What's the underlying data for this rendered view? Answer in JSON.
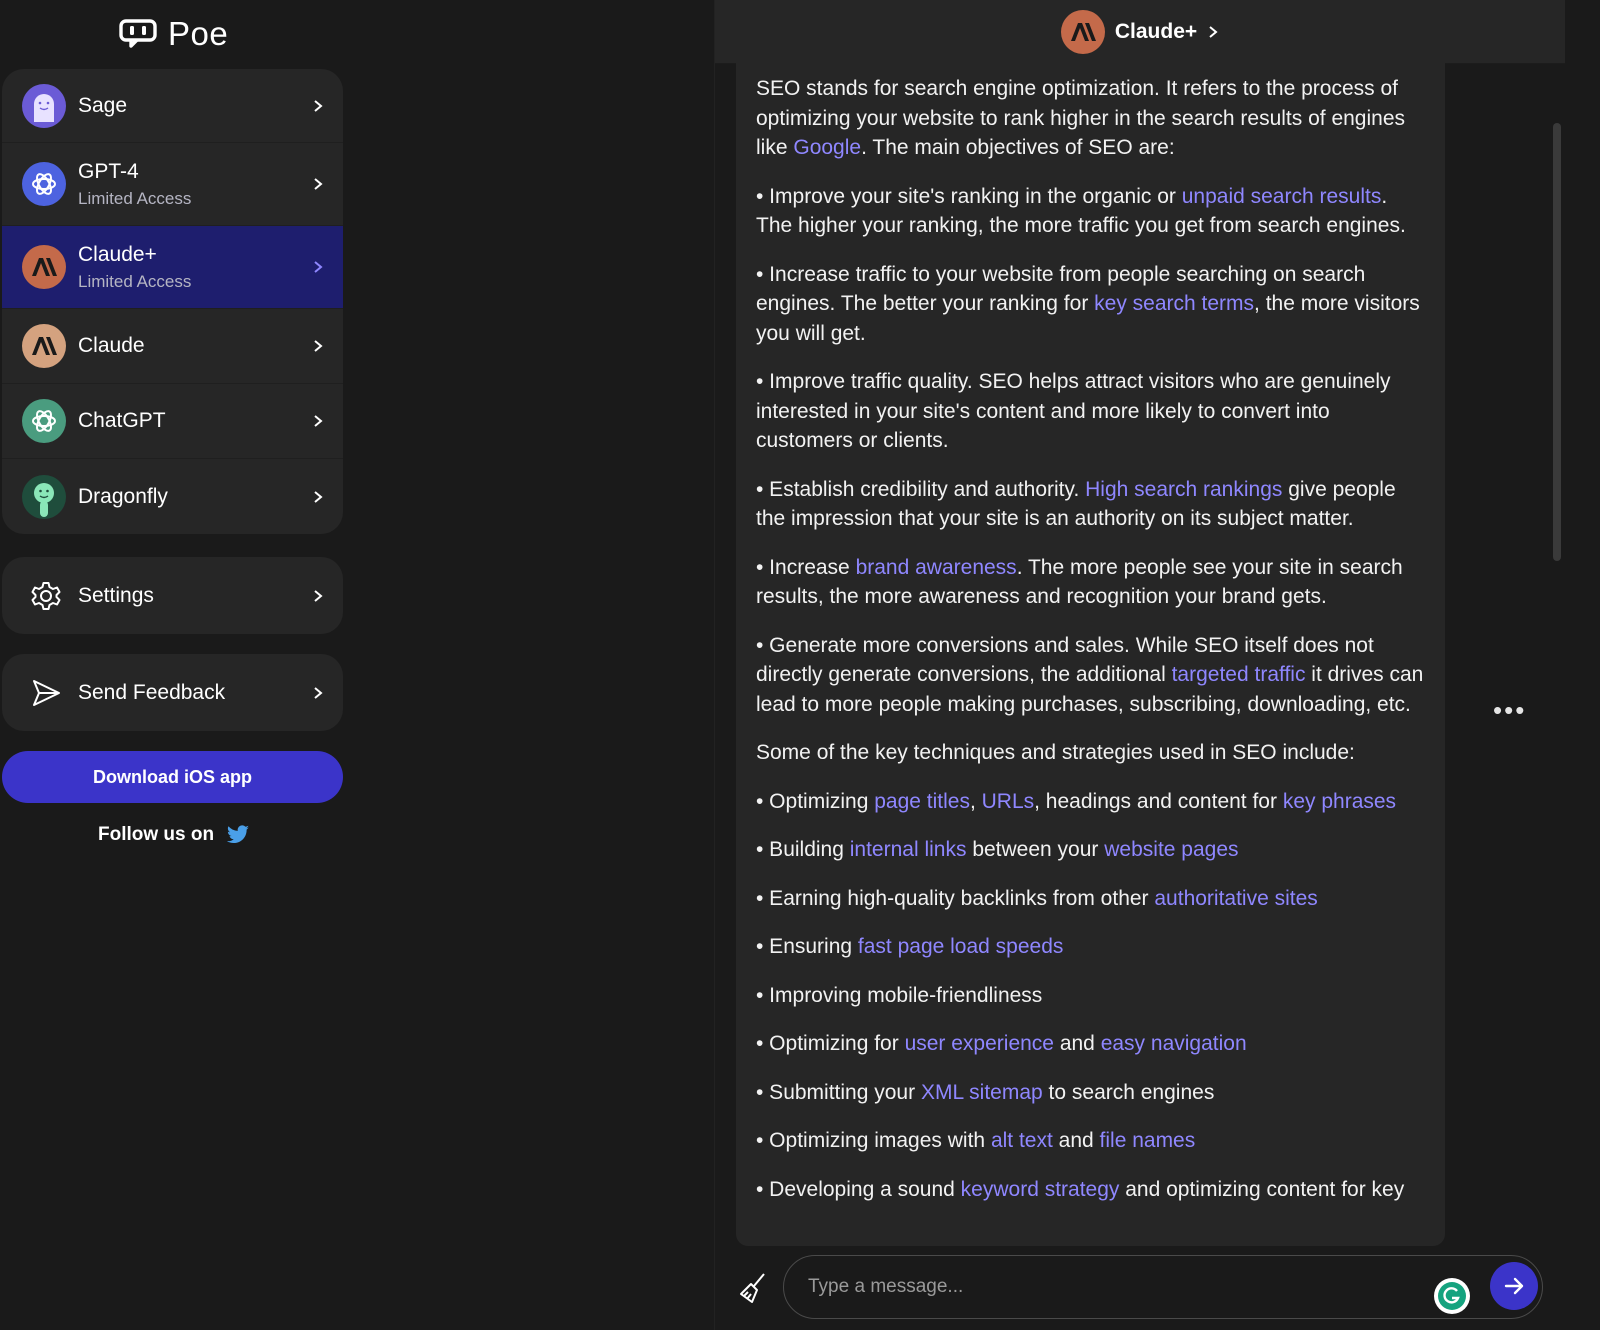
{
  "app": {
    "name": "Poe"
  },
  "sidebar": {
    "bots": [
      {
        "name": "Sage",
        "subtitle": "",
        "icon": "sage-ghost-icon",
        "active": false
      },
      {
        "name": "GPT-4",
        "subtitle": "Limited Access",
        "icon": "openai-logo-icon",
        "active": false
      },
      {
        "name": "Claude+",
        "subtitle": "Limited Access",
        "icon": "anthropic-logo-icon",
        "active": true
      },
      {
        "name": "Claude",
        "subtitle": "",
        "icon": "anthropic-logo-icon",
        "active": false
      },
      {
        "name": "ChatGPT",
        "subtitle": "",
        "icon": "openai-logo-icon",
        "active": false
      },
      {
        "name": "Dragonfly",
        "subtitle": "",
        "icon": "dragonfly-icon",
        "active": false
      }
    ],
    "settings_label": "Settings",
    "feedback_label": "Send Feedback",
    "download_label": "Download iOS app",
    "follow_label": "Follow us on"
  },
  "chat": {
    "bot_name": "Claude+",
    "avatar_text": "A\\",
    "input_placeholder": "Type a message..."
  },
  "message": {
    "paragraphs": [
      [
        {
          "t": "SEO stands for search engine optimization. It refers to the process of optimizing your website to rank higher in the search results of engines like "
        },
        {
          "t": "Google",
          "link": true
        },
        {
          "t": ". The main objectives of SEO are:"
        }
      ],
      [
        {
          "t": "• Improve your site's ranking in the organic or "
        },
        {
          "t": "unpaid search results",
          "link": true
        },
        {
          "t": ". The higher your ranking, the more traffic you get from search engines."
        }
      ],
      [
        {
          "t": "• Increase traffic to your website from people searching on search engines. The better your ranking for "
        },
        {
          "t": "key search terms",
          "link": true
        },
        {
          "t": ", the more visitors you will get."
        }
      ],
      [
        {
          "t": "• Improve traffic quality. SEO helps attract visitors who are genuinely interested in your site's content and more likely to convert into customers or clients."
        }
      ],
      [
        {
          "t": "• Establish credibility and authority. "
        },
        {
          "t": "High search rankings",
          "link": true
        },
        {
          "t": " give people the impression that your site is an authority on its subject matter."
        }
      ],
      [
        {
          "t": "• Increase "
        },
        {
          "t": "brand awareness",
          "link": true
        },
        {
          "t": ". The more people see your site in search results, the more awareness and recognition your brand gets."
        }
      ],
      [
        {
          "t": "• Generate more conversions and sales. While SEO itself does not directly generate conversions, the additional "
        },
        {
          "t": "targeted traffic",
          "link": true
        },
        {
          "t": " it drives can lead to more people making purchases, subscribing, downloading, etc."
        }
      ],
      [
        {
          "t": "Some of the key techniques and strategies used in SEO include:"
        }
      ],
      [
        {
          "t": "• Optimizing "
        },
        {
          "t": "page titles",
          "link": true
        },
        {
          "t": ", "
        },
        {
          "t": "URLs",
          "link": true
        },
        {
          "t": ", headings and content for "
        },
        {
          "t": "key phrases",
          "link": true
        }
      ],
      [
        {
          "t": "• Building "
        },
        {
          "t": "internal links",
          "link": true
        },
        {
          "t": " between your "
        },
        {
          "t": "website pages",
          "link": true
        }
      ],
      [
        {
          "t": "• Earning high-quality backlinks from other "
        },
        {
          "t": "authoritative sites",
          "link": true
        }
      ],
      [
        {
          "t": "• Ensuring "
        },
        {
          "t": "fast page load speeds",
          "link": true
        }
      ],
      [
        {
          "t": "• Improving mobile-friendliness"
        }
      ],
      [
        {
          "t": "• Optimizing for "
        },
        {
          "t": "user experience",
          "link": true
        },
        {
          "t": " and "
        },
        {
          "t": "easy navigation",
          "link": true
        }
      ],
      [
        {
          "t": "• Submitting your "
        },
        {
          "t": "XML sitemap",
          "link": true
        },
        {
          "t": " to search engines"
        }
      ],
      [
        {
          "t": "• Optimizing images with "
        },
        {
          "t": "alt text",
          "link": true
        },
        {
          "t": " and "
        },
        {
          "t": "file names",
          "link": true
        }
      ],
      [
        {
          "t": "• Developing a sound "
        },
        {
          "t": "keyword strategy",
          "link": true
        },
        {
          "t": " and optimizing content for key"
        }
      ]
    ]
  },
  "colors": {
    "accent": "#3b34c9",
    "link": "#8f87ff",
    "active_item": "#1e1e6e",
    "panel": "#262626",
    "background": "#1a1a1a"
  }
}
